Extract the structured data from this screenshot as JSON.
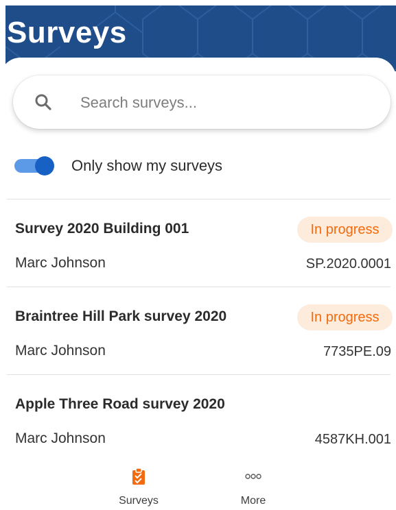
{
  "header": {
    "title": "Surveys"
  },
  "search": {
    "placeholder": "Search surveys...",
    "icon": "search-icon"
  },
  "filter": {
    "toggle_label": "Only show my surveys",
    "toggle_on": true,
    "accent": "#1760c4"
  },
  "surveys": [
    {
      "title": "Survey 2020 Building 001",
      "owner": "Marc Johnson",
      "code": "SP.2020.0001",
      "status": "In progress"
    },
    {
      "title": "Braintree Hill Park survey 2020",
      "owner": "Marc Johnson",
      "code": "7735PE.09",
      "status": "In progress"
    },
    {
      "title": "Apple Three Road survey 2020",
      "owner": "Marc Johnson",
      "code": "4587KH.001",
      "status": ""
    }
  ],
  "nav": {
    "items": [
      {
        "label": "Surveys",
        "icon": "clipboard-icon",
        "active": true
      },
      {
        "label": "More",
        "icon": "more-dots-icon",
        "active": false
      }
    ]
  },
  "colors": {
    "header_bg": "#1f4d8a",
    "badge_text": "#f26b10",
    "badge_bg": "#fdebdc"
  }
}
